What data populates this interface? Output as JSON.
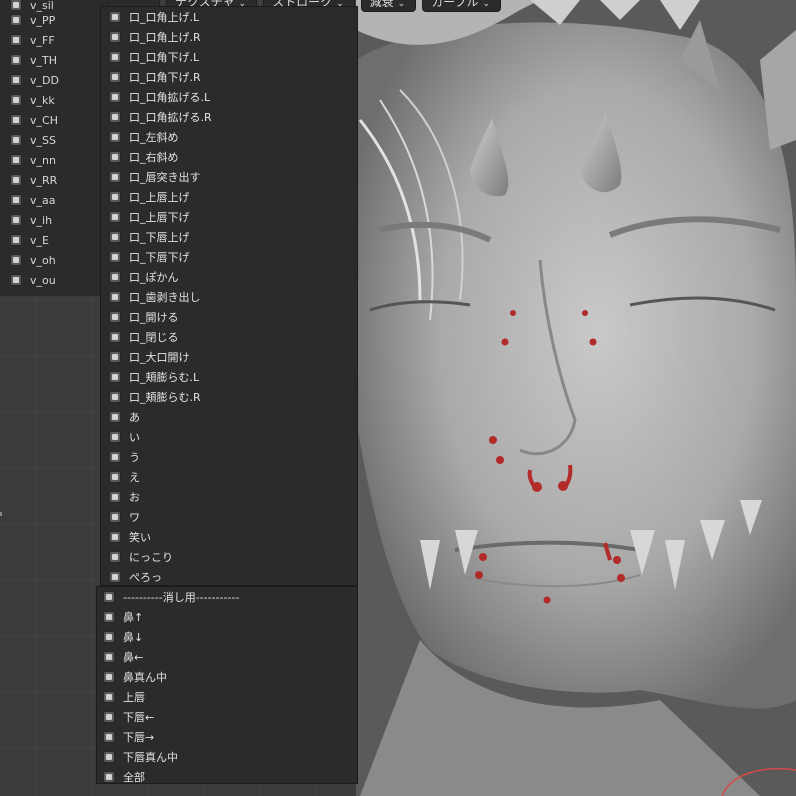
{
  "header": {
    "buttons": [
      "テクスチャ",
      "ストローク",
      "減衰",
      "カーブル"
    ]
  },
  "left_list": [
    "v_sil",
    "v_PP",
    "v_FF",
    "v_TH",
    "v_DD",
    "v_kk",
    "v_CH",
    "v_SS",
    "v_nn",
    "v_RR",
    "v_aa",
    "v_ih",
    "v_E",
    "v_oh",
    "v_ou"
  ],
  "menu_items": [
    "口_口角上げ.L",
    "口_口角上げ.R",
    "口_口角下げ.L",
    "口_口角下げ.R",
    "口_口角拡げる.L",
    "口_口角拡げる.R",
    "口_左斜め",
    "口_右斜め",
    "口_唇突き出す",
    "口_上唇上げ",
    "口_上唇下げ",
    "口_下唇上げ",
    "口_下唇下げ",
    "口_ぽかん",
    "口_歯剥き出し",
    "口_開ける",
    "口_閉じる",
    "口_大口開け",
    "口_頬膨らむ.L",
    "口_頬膨らむ.R",
    "あ",
    "い",
    "う",
    "え",
    "お",
    "ワ",
    "笑い",
    "にっこり",
    "ぺろっ"
  ],
  "menu2_items": [
    "----------消し用-----------",
    "鼻↑",
    "鼻↓",
    "鼻←",
    "鼻真ん中",
    "上唇",
    "下唇←",
    "下唇→",
    "下唇真ん中",
    "全部"
  ],
  "icon": "checkbox-icon"
}
